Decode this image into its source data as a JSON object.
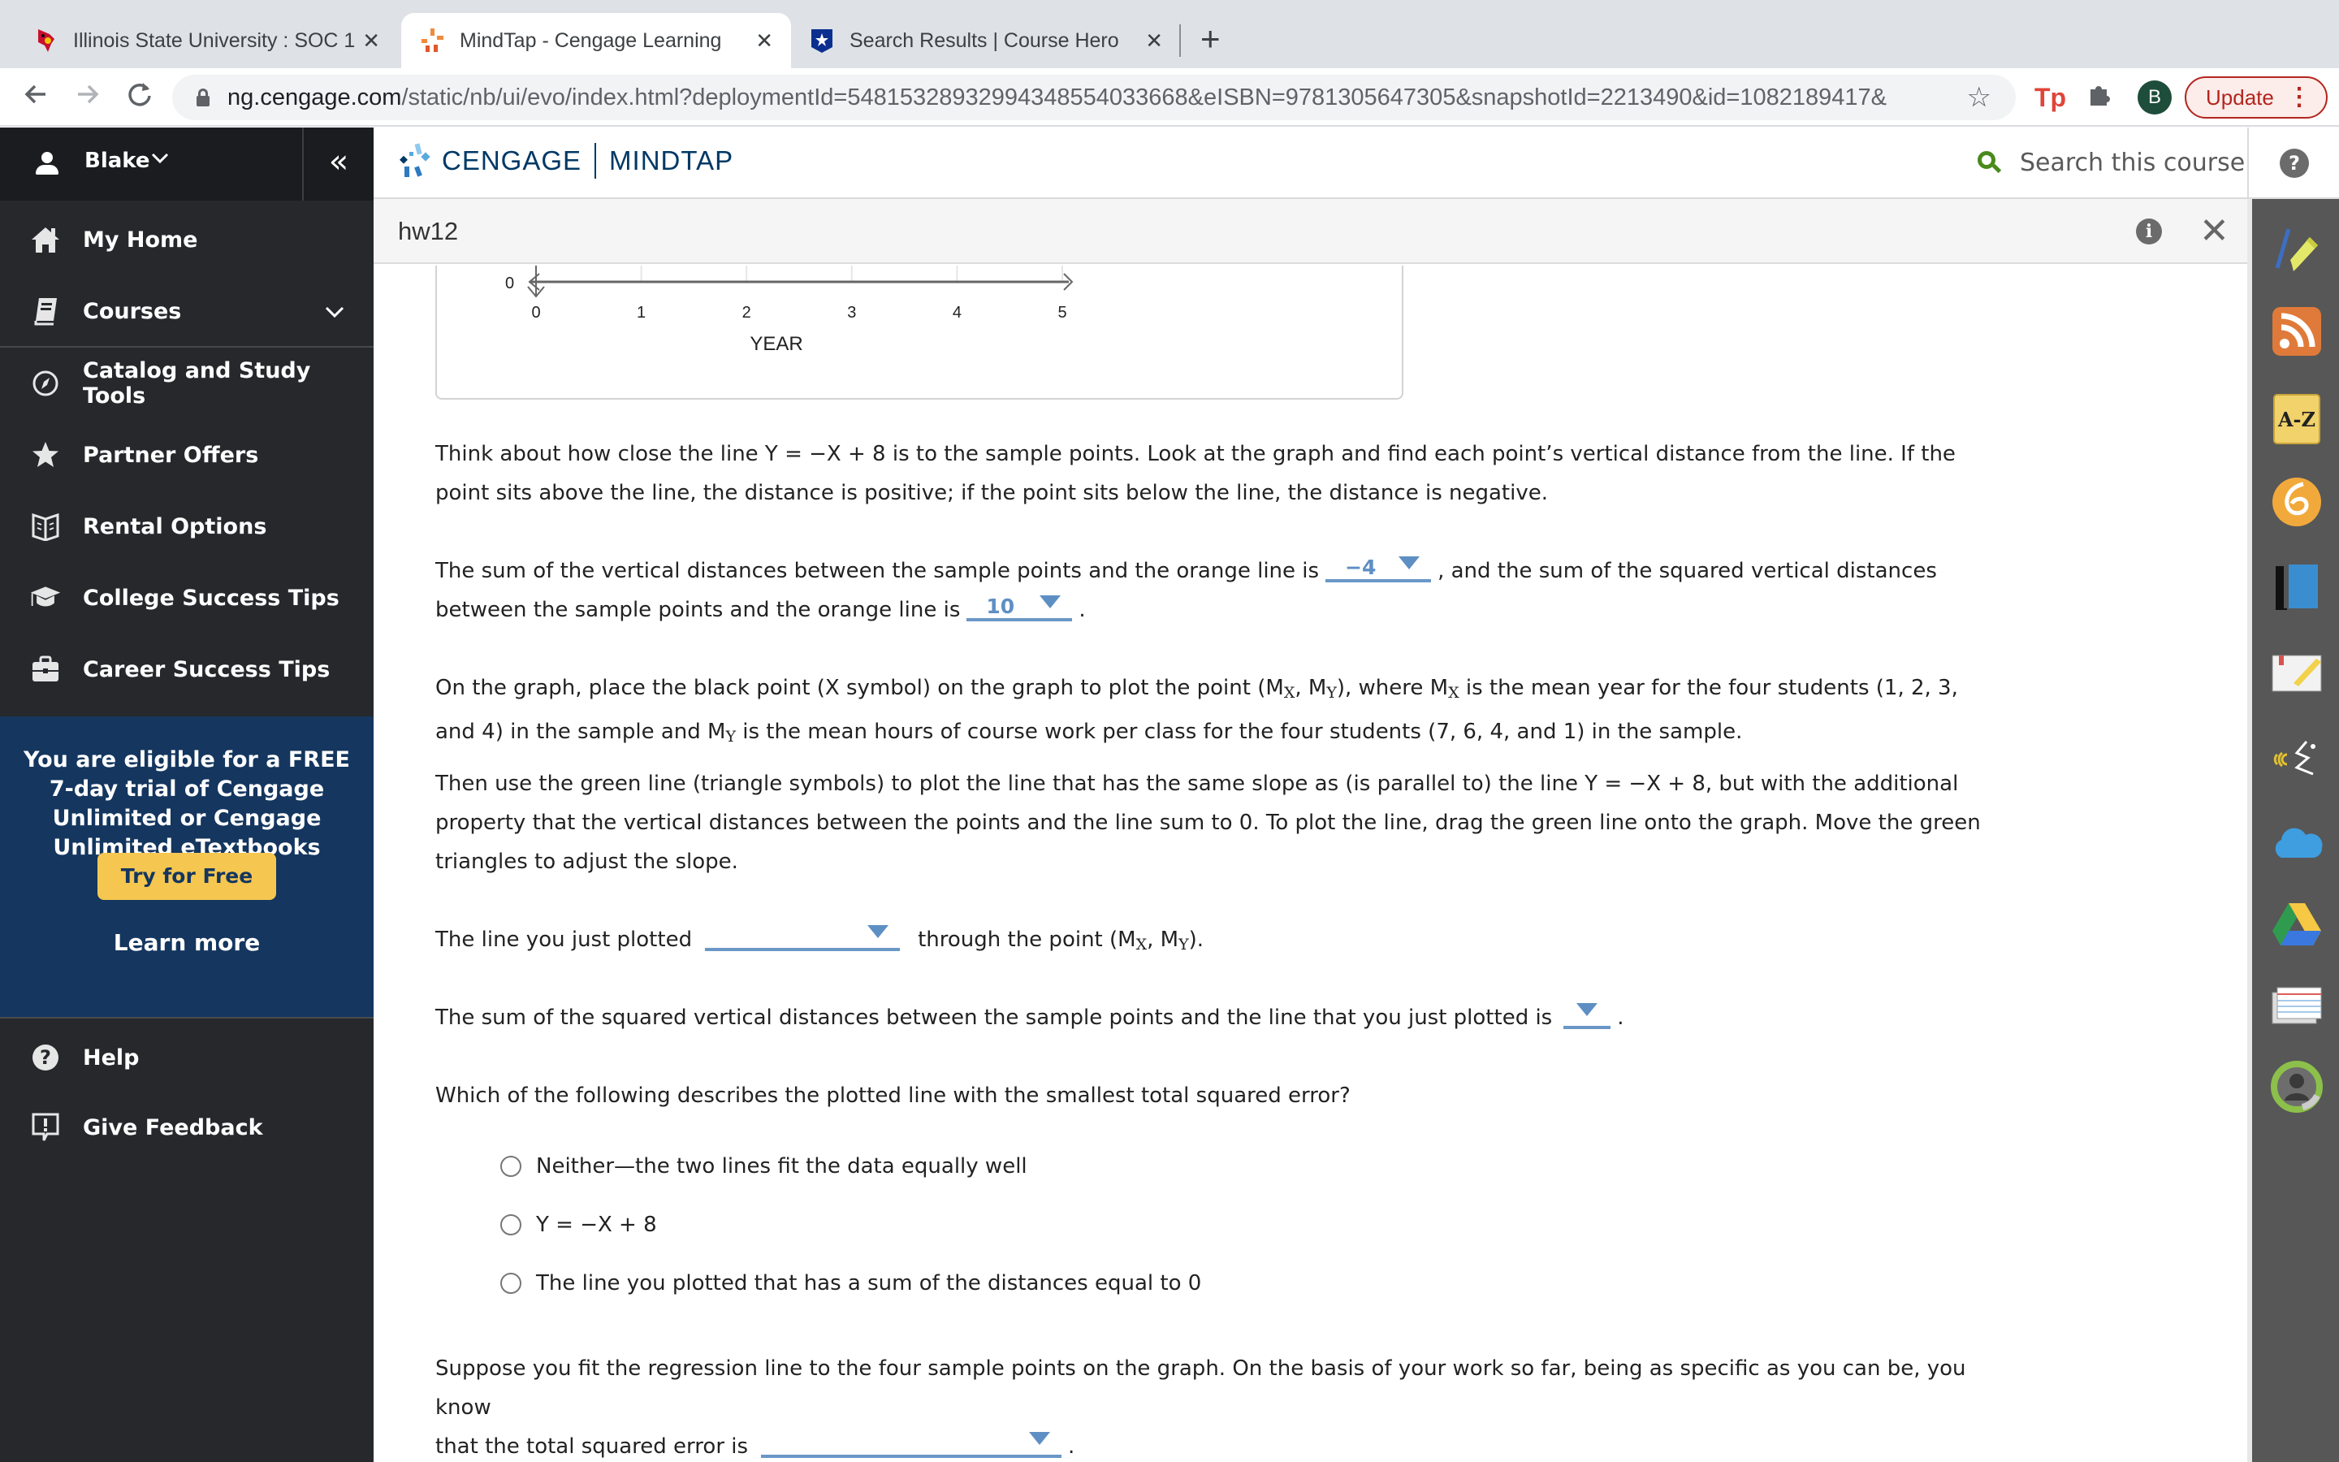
{
  "browser": {
    "tabs": [
      {
        "title": "Illinois State University : SOC 1",
        "icon": "redbird-icon",
        "active": false
      },
      {
        "title": "MindTap - Cengage Learning",
        "icon": "mindtap-icon",
        "active": true
      },
      {
        "title": "Search Results | Course Hero",
        "icon": "coursehero-icon",
        "active": false
      }
    ],
    "close_glyph": "✕",
    "new_tab_glyph": "+",
    "url_host": "ng.cengage.com",
    "url_path": "/static/nb/ui/evo/index.html?deploymentId=5481532893299434855403366 8&eISBN=9781305647305&snapshotId=2213490&id=1082189417&",
    "profile_initial": "B",
    "update_label": "Update",
    "extension_tp": "Tp"
  },
  "sidebar": {
    "user_name": "Blake",
    "items": [
      {
        "label": "My Home",
        "icon": "home-icon"
      },
      {
        "label": "Courses",
        "icon": "book-icon",
        "has_caret": true
      },
      {
        "label": "Catalog and Study Tools",
        "icon": "compass-icon"
      },
      {
        "label": "Partner Offers",
        "icon": "star-icon"
      },
      {
        "label": "Rental Options",
        "icon": "open-book-icon"
      },
      {
        "label": "College Success Tips",
        "icon": "graduation-cap-icon"
      },
      {
        "label": "Career Success Tips",
        "icon": "briefcase-icon"
      }
    ],
    "promo": {
      "text": "You are eligible for a FREE 7-day trial of Cengage Unlimited or Cengage Unlimited eTextbooks",
      "button": "Try for Free",
      "link": "Learn more"
    },
    "footer_items": [
      {
        "label": "Help",
        "icon": "help-icon"
      },
      {
        "label": "Give Feedback",
        "icon": "feedback-icon"
      }
    ]
  },
  "header": {
    "brand_left": "CENGAGE",
    "brand_right": "MINDTAP",
    "search_placeholder": "Search this course",
    "help_glyph": "?"
  },
  "activity": {
    "title": "hw12",
    "info_glyph": "i",
    "close_glyph": "✕"
  },
  "dock": {
    "items": [
      "highlighter-icon",
      "rss-icon",
      "glossary-az-icon",
      "cengage-6-icon",
      "ebook-icon",
      "notebook-icon",
      "readspeaker-icon",
      "onedrive-icon",
      "google-drive-icon",
      "flashcards-icon",
      "profile-progress-icon"
    ],
    "az_label": "A-Z"
  },
  "chart_data": {
    "type": "scatter",
    "title": "",
    "xlabel": "YEAR",
    "ylabel": "",
    "x_ticks": [
      0,
      1,
      2,
      3,
      4,
      5
    ],
    "y_ticks_visible": [
      0
    ],
    "xlim": [
      0,
      5
    ],
    "grid": true,
    "note": "Graph is scrolled; only the x-axis portion is visible"
  },
  "question": {
    "p1": "Think about how close the line Y = −X + 8 is to the sample points. Look at the graph and find each point’s vertical distance from the line. If the point sits above the line, the distance is positive; if the point sits below the line, the distance is negative.",
    "p2_a": "The sum of the vertical distances between the sample points and the orange line is",
    "dd_sum_value": "−4",
    "p2_b": ", and the sum of the squared vertical distances",
    "p2_c": "between the sample points and the orange line is",
    "dd_sq_value": "10",
    "period": ".",
    "p3_a": "On the graph, place the black point (X symbol) on the graph to plot the point (M",
    "sub_x": "X",
    "sub_y": "Y",
    "comma_m": ", M",
    "p3_b": "), where M",
    "p3_c": " is the mean year for the four students (1, 2, 3,",
    "p3_d": "and 4) in the sample and M",
    "p3_e": " is the mean hours of course work per class for the four students (7, 6, 4, and 1) in the sample.",
    "p4": "Then use the green line (triangle symbols) to plot the line that has the same slope as (is parallel to) the line Y = −X + 8, but with the additional property that the vertical distances between the points and the line sum to 0. To plot the line, drag the green line onto the graph. Move the green triangles to adjust the slope.",
    "p5_a": "The line you just plotted",
    "p5_b": "through the point (M",
    "p5_c": ").",
    "p6": "The sum of the squared vertical distances between the sample points and the line that you just plotted is",
    "p7": "Which of the following describes the plotted line with the smallest total squared error?",
    "options": [
      "Neither—the two lines fit the data equally well",
      "Y = −X + 8",
      "The line you plotted that has a sum of the distances equal to 0"
    ],
    "p8_a": "Suppose you fit the regression line to the four sample points on the graph. On the basis of your work so far, being as specific as you can be, you know",
    "p8_b": "that the total squared error is"
  }
}
